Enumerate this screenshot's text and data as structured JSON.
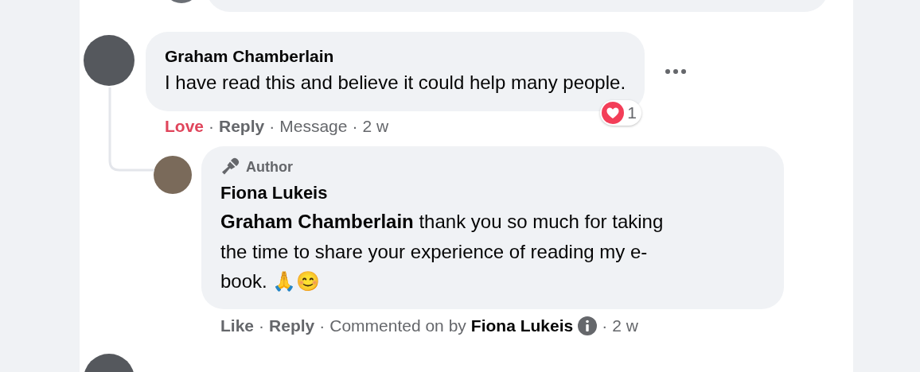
{
  "separator": "·",
  "comment": {
    "author": "Graham Chamberlain",
    "text": "I have read this and believe it could help many people.",
    "reaction_count": "1",
    "actions": [
      {
        "label": "Love",
        "kind": "react",
        "selected": true
      },
      {
        "label": "Reply",
        "kind": "link"
      },
      {
        "label": "Message",
        "kind": "meta"
      },
      {
        "label": "2 w",
        "kind": "meta"
      }
    ]
  },
  "reply": {
    "badge": "Author",
    "author": "Fiona Lukeis",
    "text": "**Graham Chamberlain** thank you so much for taking the time to share your experience of reading my e-book. 🙏😊",
    "actions": [
      {
        "label": "Like",
        "kind": "react",
        "selected": false
      },
      {
        "label": "Reply",
        "kind": "link"
      },
      {
        "label": "Commented on by",
        "kind": "meta"
      },
      {
        "label": "Fiona Lukeis",
        "kind": "name"
      },
      {
        "label": "2 w",
        "kind": "meta"
      }
    ]
  }
}
